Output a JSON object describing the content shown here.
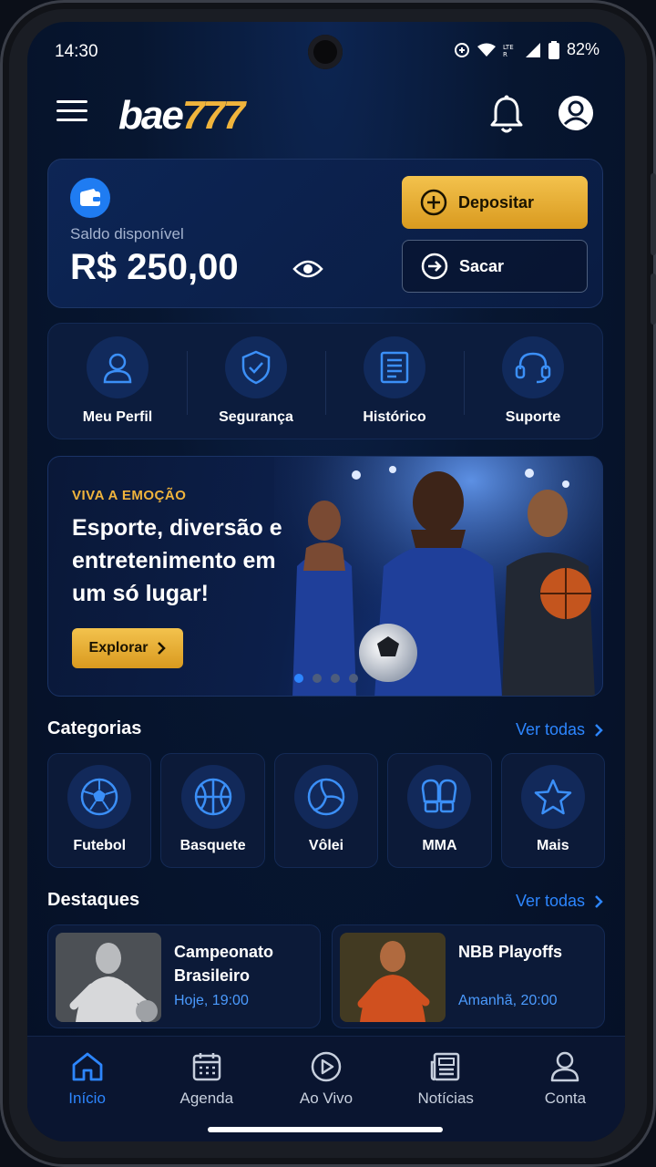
{
  "status_bar": {
    "time": "14:30",
    "battery": "82%"
  },
  "header": {
    "logo_part1": "bae",
    "logo_part2": "777"
  },
  "balance": {
    "label": "Saldo disponível",
    "value": "R$ 250,00",
    "deposit_label": "Depositar",
    "withdraw_label": "Sacar"
  },
  "quick_actions": [
    {
      "label": "Meu Perfil",
      "icon": "user-icon"
    },
    {
      "label": "Segurança",
      "icon": "shield-check-icon"
    },
    {
      "label": "Histórico",
      "icon": "document-list-icon"
    },
    {
      "label": "Suporte",
      "icon": "headset-icon"
    }
  ],
  "banner": {
    "kicker": "VIVA A EMOÇÃO",
    "title": "Esporte, diversão e entretenimento em um só lugar!",
    "button_label": "Explorar",
    "slide_count": 4,
    "active_slide": 1
  },
  "categories": {
    "title": "Categorias",
    "see_all": "Ver todas",
    "items": [
      {
        "label": "Futebol",
        "icon": "soccer-ball-icon"
      },
      {
        "label": "Basquete",
        "icon": "basketball-icon"
      },
      {
        "label": "Vôlei",
        "icon": "volleyball-icon"
      },
      {
        "label": "MMA",
        "icon": "boxing-gloves-icon"
      },
      {
        "label": "Mais",
        "icon": "star-icon"
      }
    ]
  },
  "highlights": {
    "title": "Destaques",
    "see_all": "Ver todas",
    "items": [
      {
        "name": "Campeonato Brasileiro",
        "time": "Hoje, 19:00"
      },
      {
        "name": "NBB Playoffs",
        "time": "Amanhã, 20:00"
      }
    ]
  },
  "bottom_nav": [
    {
      "label": "Início",
      "icon": "home-icon",
      "active": true
    },
    {
      "label": "Agenda",
      "icon": "calendar-icon",
      "active": false
    },
    {
      "label": "Ao Vivo",
      "icon": "play-icon",
      "active": false
    },
    {
      "label": "Notícias",
      "icon": "news-icon",
      "active": false
    },
    {
      "label": "Conta",
      "icon": "user-icon",
      "active": false
    }
  ],
  "colors": {
    "accent": "#2d86ff",
    "gold": "#f0b43c",
    "background": "#071630"
  }
}
